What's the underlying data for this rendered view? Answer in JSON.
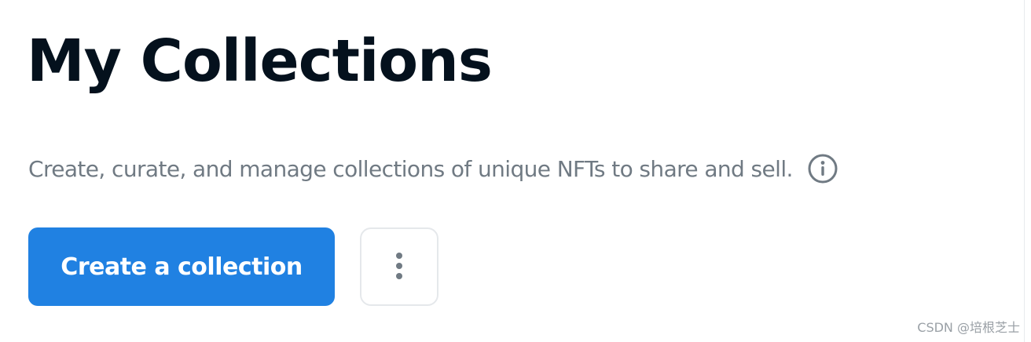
{
  "header": {
    "title": "My Collections"
  },
  "description": {
    "text": "Create, curate, and manage collections of unique NFTs to share and sell.",
    "icon": "info-icon"
  },
  "actions": {
    "create_label": "Create a collection",
    "more_icon": "more-vertical-icon"
  },
  "watermark": {
    "text": "CSDN @培根芝士"
  },
  "colors": {
    "title": "#04111d",
    "subtitle": "#707a83",
    "primary_button": "#2081e2",
    "button_border": "#e5e8eb"
  }
}
